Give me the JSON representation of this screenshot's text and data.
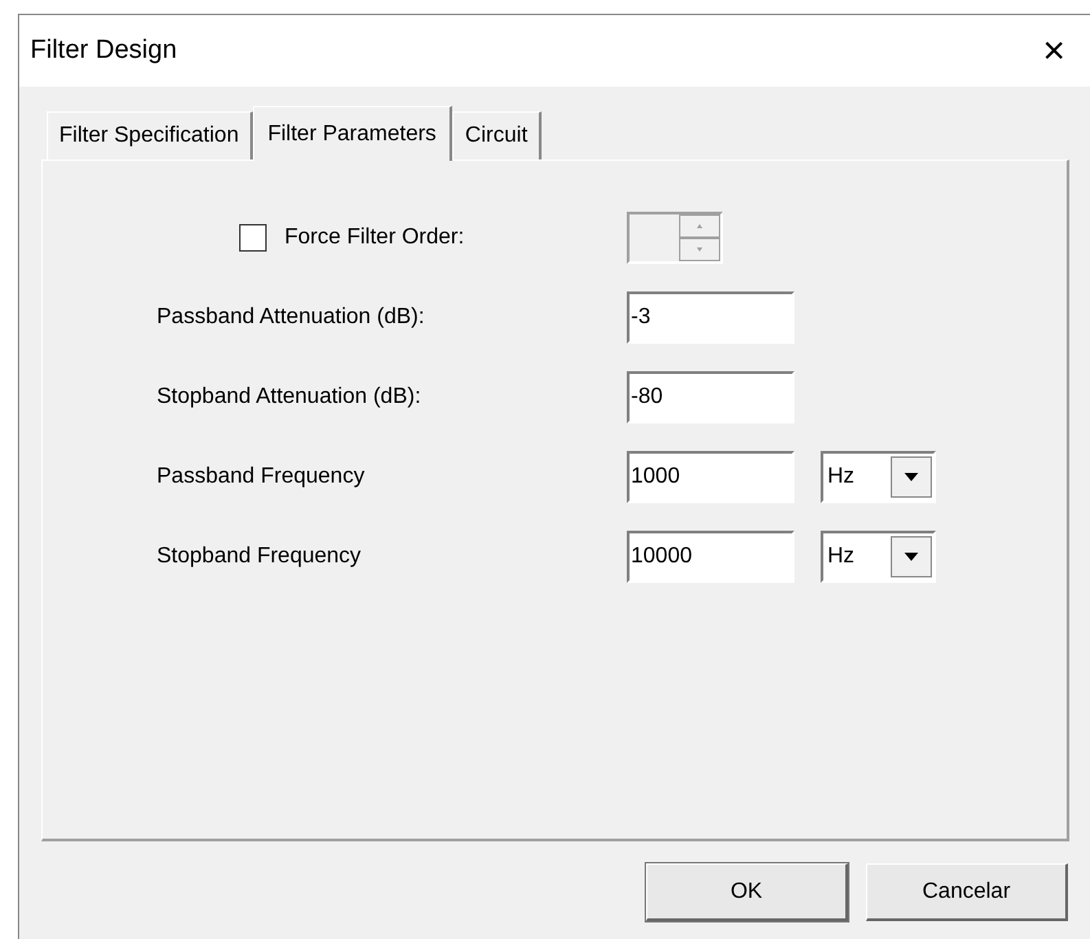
{
  "window": {
    "title": "Filter Design",
    "close": "×"
  },
  "tabs": [
    {
      "label": "Filter Specification",
      "selected": false
    },
    {
      "label": "Filter Parameters",
      "selected": true
    },
    {
      "label": "Circuit",
      "selected": false
    }
  ],
  "fields": [
    {
      "kind": "checkbox_spinner",
      "label": "Force Filter Order:",
      "checked": false,
      "disabled": true
    },
    {
      "kind": "text",
      "label": "Passband Attenuation (dB):",
      "value": "-3"
    },
    {
      "kind": "text",
      "label": "Stopband Attenuation (dB):",
      "value": "-80"
    },
    {
      "kind": "text_unit",
      "label": "Passband Frequency",
      "value": "1000",
      "unit": "Hz"
    },
    {
      "kind": "text_unit",
      "label": "Stopband Frequency",
      "value": "10000",
      "unit": "Hz"
    }
  ],
  "buttons": [
    "OK",
    "Cancelar"
  ]
}
